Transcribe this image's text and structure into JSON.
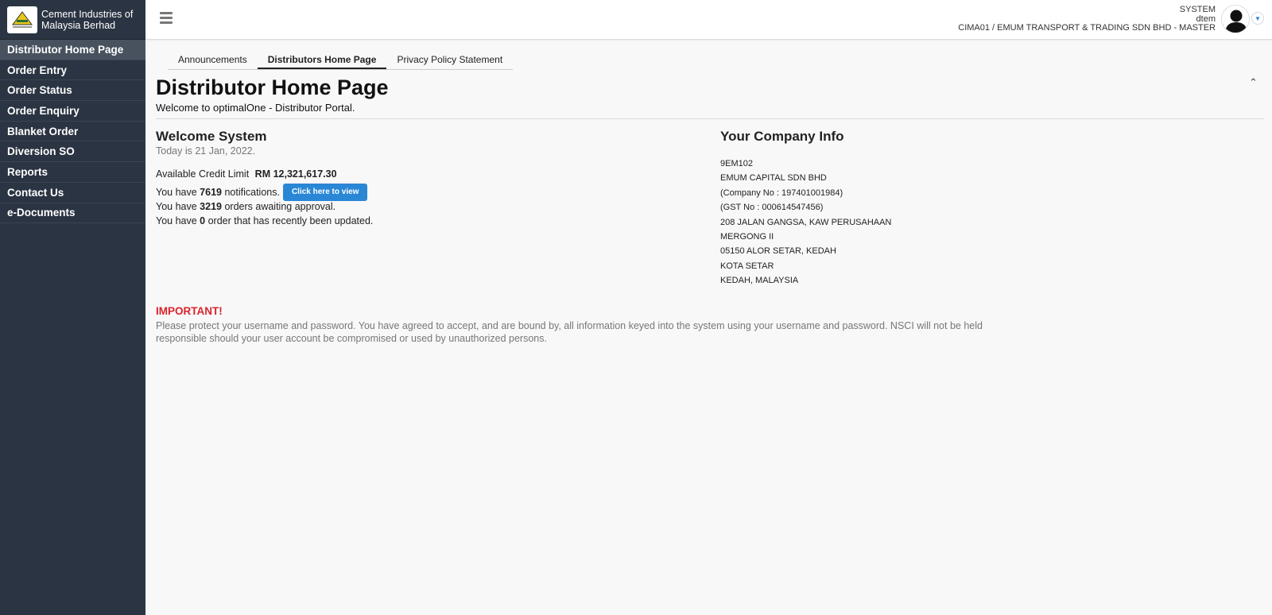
{
  "brand": {
    "name_line1": "Cement Industries of",
    "name_line2": "Malaysia Berhad"
  },
  "sidebar": {
    "items": [
      {
        "label": "Distributor Home Page",
        "active": true
      },
      {
        "label": "Order Entry"
      },
      {
        "label": "Order Status"
      },
      {
        "label": "Order Enquiry"
      },
      {
        "label": "Blanket Order"
      },
      {
        "label": "Diversion SO"
      },
      {
        "label": "Reports"
      },
      {
        "label": "Contact Us"
      },
      {
        "label": "e-Documents"
      }
    ]
  },
  "topbar": {
    "user_line1": "SYSTEM",
    "user_line2": "dtem",
    "user_line3": "CIMA01 / EMUM TRANSPORT & TRADING SDN BHD - MASTER"
  },
  "tabs": [
    {
      "label": "Announcements"
    },
    {
      "label": "Distributors Home Page",
      "active": true
    },
    {
      "label": "Privacy Policy Statement"
    }
  ],
  "main": {
    "title": "Distributor Home Page",
    "subtitle": "Welcome to optimalOne - Distributor Portal.",
    "welcome_title": "Welcome System",
    "today": "Today is 21 Jan, 2022.",
    "credit_label": "Available Credit Limit",
    "credit_value": "RM 12,321,617.30",
    "notif_prefix": "You have",
    "notif_count": "7619",
    "notif_suffix": "notifications.",
    "view_button": "Click here to view",
    "approval_prefix": "You have",
    "approval_count": "3219",
    "approval_suffix": "orders awaiting approval.",
    "updated_prefix": "You have",
    "updated_count": "0",
    "updated_suffix": "order that has recently been updated."
  },
  "company": {
    "title": "Your Company Info",
    "lines": [
      "9EM102",
      "EMUM CAPITAL SDN BHD",
      "(Company No : 197401001984)",
      "(GST No : 000614547456)",
      "208 JALAN GANGSA, KAW PERUSAHAAN",
      "MERGONG II",
      "05150 ALOR SETAR, KEDAH",
      "KOTA SETAR",
      "KEDAH, MALAYSIA"
    ]
  },
  "important": {
    "label": "IMPORTANT!",
    "text": "Please protect your username and password. You have agreed to accept, and are bound by, all information keyed into the system using your username and password. NSCI will not be held responsible should your user account be compromised or used by unauthorized persons."
  },
  "colors": {
    "sidebar_bg": "#2b3442",
    "accent": "#2a87d6",
    "important": "#d9232d"
  },
  "icons": {
    "menu": "hamburger-icon",
    "collapse": "chevron-up-icon",
    "user_dropdown": "chevron-down-icon",
    "avatar": "user-avatar-icon"
  }
}
